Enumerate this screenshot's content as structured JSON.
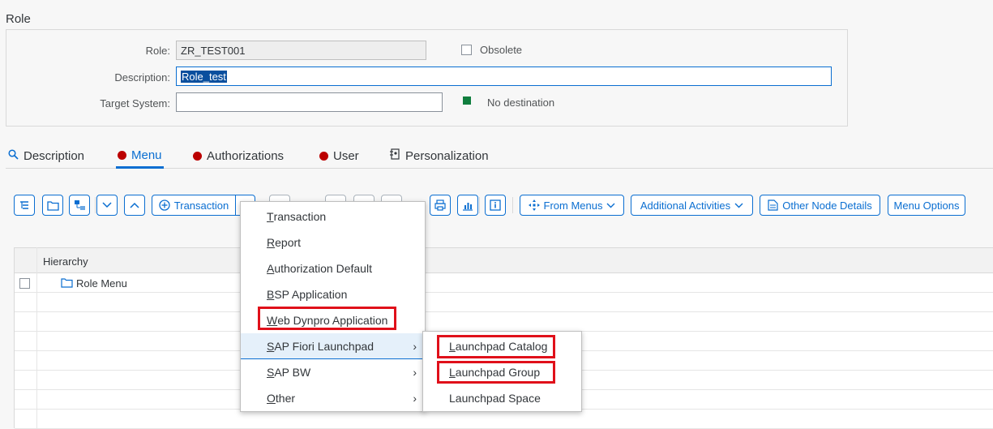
{
  "page": {
    "title": "Role"
  },
  "header": {
    "role_label": "Role:",
    "role_value": "ZR_TEST001",
    "obsolete_label": "Obsolete",
    "description_label": "Description:",
    "description_value": "Role_test",
    "target_label": "Target System:",
    "target_value": "",
    "destination_status": "No destination",
    "status_color": "#107e3e"
  },
  "tabs": [
    {
      "label": "Description",
      "icon": "search-icon"
    },
    {
      "label": "Menu",
      "icon": "status-dot",
      "active": true
    },
    {
      "label": "Authorizations",
      "icon": "status-dot"
    },
    {
      "label": "User",
      "icon": "status-dot"
    },
    {
      "label": "Personalization",
      "icon": "personalization-icon"
    }
  ],
  "toolbar": {
    "transaction_label": "Transaction",
    "from_menus_label": "From Menus",
    "additional_label": "Additional Activities",
    "other_node_label": "Other Node Details",
    "menu_options_label": "Menu Options"
  },
  "grid": {
    "column_header": "Hierarchy",
    "rows": [
      {
        "label": "Role Menu"
      }
    ]
  },
  "dropdown": {
    "items": [
      {
        "first": "T",
        "rest": "ransaction"
      },
      {
        "first": "R",
        "rest": "eport"
      },
      {
        "first": "A",
        "rest": "uthorization Default"
      },
      {
        "first": "B",
        "rest": "SP Application"
      },
      {
        "first": "W",
        "rest": "eb Dynpro Application"
      },
      {
        "first": "S",
        "rest": "AP Fiori Launchpad"
      },
      {
        "first": "S",
        "rest": "AP BW"
      },
      {
        "first": "O",
        "rest": "ther"
      }
    ]
  },
  "submenu": {
    "items": [
      {
        "first": "L",
        "rest": "aunchpad Catalog"
      },
      {
        "first": "L",
        "rest": "aunchpad Group"
      },
      {
        "first": "",
        "rest": "Launchpad Space"
      }
    ]
  },
  "colors": {
    "accent": "#0a6ed1",
    "highlight": "#e0101a",
    "status_red": "#bb0000"
  }
}
